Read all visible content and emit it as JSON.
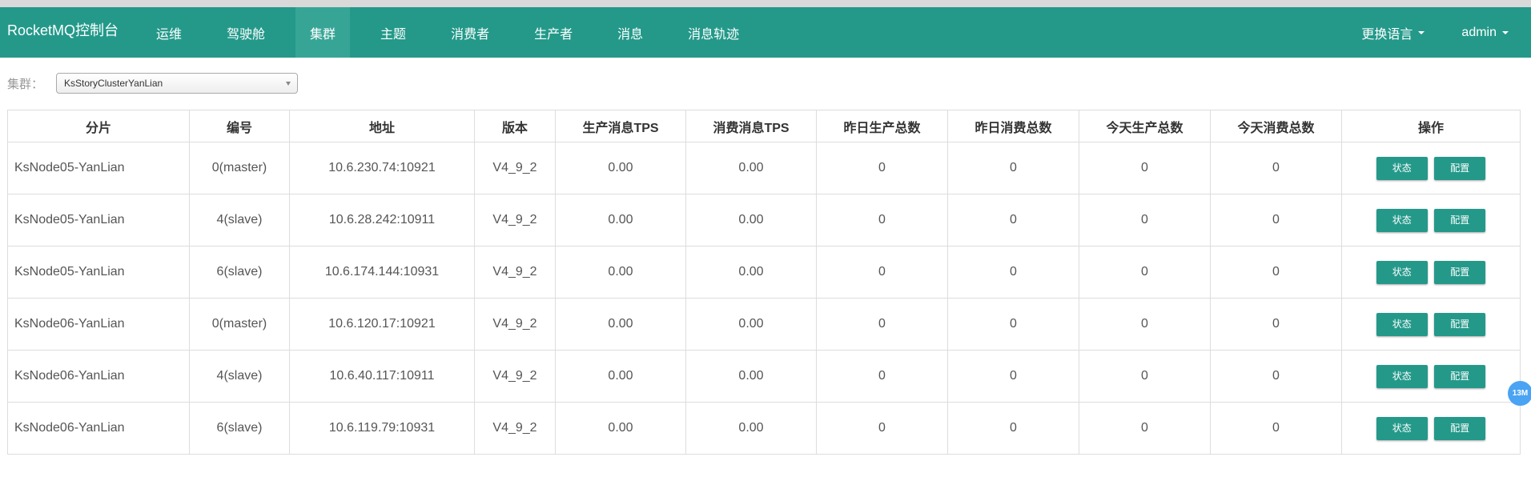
{
  "app": {
    "brand": "RocketMQ控制台"
  },
  "nav": {
    "items": [
      {
        "label": "运维"
      },
      {
        "label": "驾驶舱"
      },
      {
        "label": "集群"
      },
      {
        "label": "主题"
      },
      {
        "label": "消费者"
      },
      {
        "label": "生产者"
      },
      {
        "label": "消息"
      },
      {
        "label": "消息轨迹"
      }
    ],
    "active": "集群",
    "language_label": "更换语言",
    "user_label": "admin"
  },
  "filter": {
    "label": "集群：",
    "selected": "KsStoryClusterYanLian"
  },
  "table": {
    "headers": [
      "分片",
      "编号",
      "地址",
      "版本",
      "生产消息TPS",
      "消费消息TPS",
      "昨日生产总数",
      "昨日消费总数",
      "今天生产总数",
      "今天消费总数",
      "操作"
    ],
    "action_labels": {
      "status": "状态",
      "config": "配置"
    },
    "rows": [
      {
        "shard": "KsNode05-YanLian",
        "id": "0(master)",
        "address": "10.6.230.74:10921",
        "version": "V4_9_2",
        "produce_tps": "0.00",
        "consume_tps": "0.00",
        "yesterday_produce": "0",
        "yesterday_consume": "0",
        "today_produce": "0",
        "today_consume": "0"
      },
      {
        "shard": "KsNode05-YanLian",
        "id": "4(slave)",
        "address": "10.6.28.242:10911",
        "version": "V4_9_2",
        "produce_tps": "0.00",
        "consume_tps": "0.00",
        "yesterday_produce": "0",
        "yesterday_consume": "0",
        "today_produce": "0",
        "today_consume": "0"
      },
      {
        "shard": "KsNode05-YanLian",
        "id": "6(slave)",
        "address": "10.6.174.144:10931",
        "version": "V4_9_2",
        "produce_tps": "0.00",
        "consume_tps": "0.00",
        "yesterday_produce": "0",
        "yesterday_consume": "0",
        "today_produce": "0",
        "today_consume": "0"
      },
      {
        "shard": "KsNode06-YanLian",
        "id": "0(master)",
        "address": "10.6.120.17:10921",
        "version": "V4_9_2",
        "produce_tps": "0.00",
        "consume_tps": "0.00",
        "yesterday_produce": "0",
        "yesterday_consume": "0",
        "today_produce": "0",
        "today_consume": "0"
      },
      {
        "shard": "KsNode06-YanLian",
        "id": "4(slave)",
        "address": "10.6.40.117:10911",
        "version": "V4_9_2",
        "produce_tps": "0.00",
        "consume_tps": "0.00",
        "yesterday_produce": "0",
        "yesterday_consume": "0",
        "today_produce": "0",
        "today_consume": "0"
      },
      {
        "shard": "KsNode06-YanLian",
        "id": "6(slave)",
        "address": "10.6.119.79:10931",
        "version": "V4_9_2",
        "produce_tps": "0.00",
        "consume_tps": "0.00",
        "yesterday_produce": "0",
        "yesterday_consume": "0",
        "today_produce": "0",
        "today_consume": "0"
      }
    ]
  },
  "badge": {
    "text": "13M"
  },
  "colors": {
    "primary": "#24998a",
    "active_nav": "#37a596",
    "badge": "#4aa3f3"
  }
}
